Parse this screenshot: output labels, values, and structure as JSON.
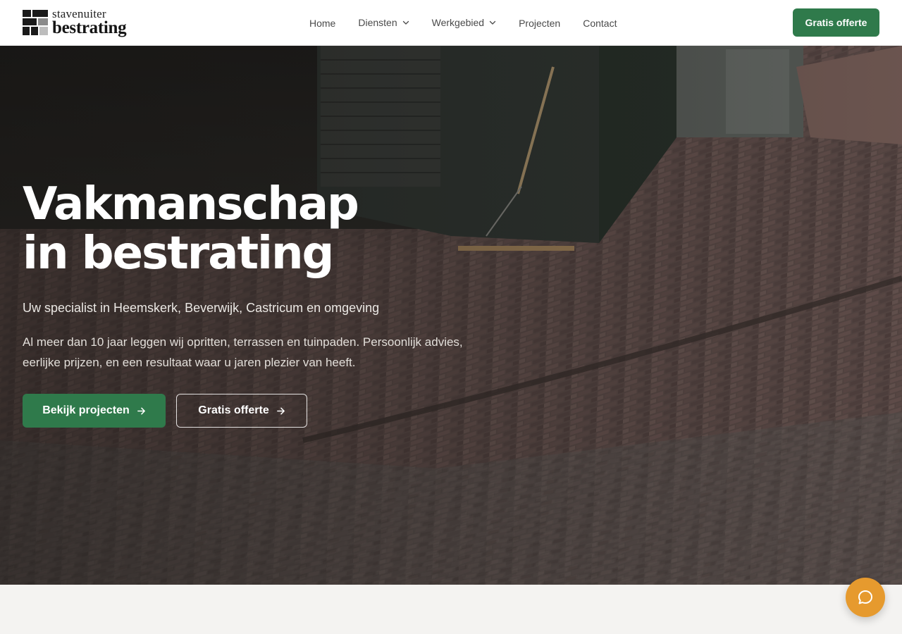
{
  "brand": {
    "name_top": "stavenuiter",
    "name_bottom": "bestrating",
    "accent_color": "#2f7a4b",
    "chat_color": "#e69a2e"
  },
  "nav": {
    "items": [
      {
        "label": "Home",
        "has_dropdown": false
      },
      {
        "label": "Diensten",
        "has_dropdown": true
      },
      {
        "label": "Werkgebied",
        "has_dropdown": true
      },
      {
        "label": "Projecten",
        "has_dropdown": false
      },
      {
        "label": "Contact",
        "has_dropdown": false
      }
    ],
    "cta_label": "Gratis offerte"
  },
  "hero": {
    "title_line1": "Vakmanschap",
    "title_line2_prefix": "in ",
    "title_highlight": "bestrating",
    "subtitle": "Uw specialist in Heemskerk, Beverwijk, Castricum en omgeving",
    "description": "Al meer dan 10 jaar leggen wij opritten, terrassen en tuinpaden. Persoonlijk advies, eerlijke prijzen, en een resultaat waar u jaren plezier van heeft.",
    "primary_button": "Bekijk projecten",
    "secondary_button": "Gratis offerte"
  },
  "icons": {
    "chat": "chat-bubble-icon",
    "arrow": "arrow-right-icon",
    "chevron": "chevron-down-icon"
  }
}
